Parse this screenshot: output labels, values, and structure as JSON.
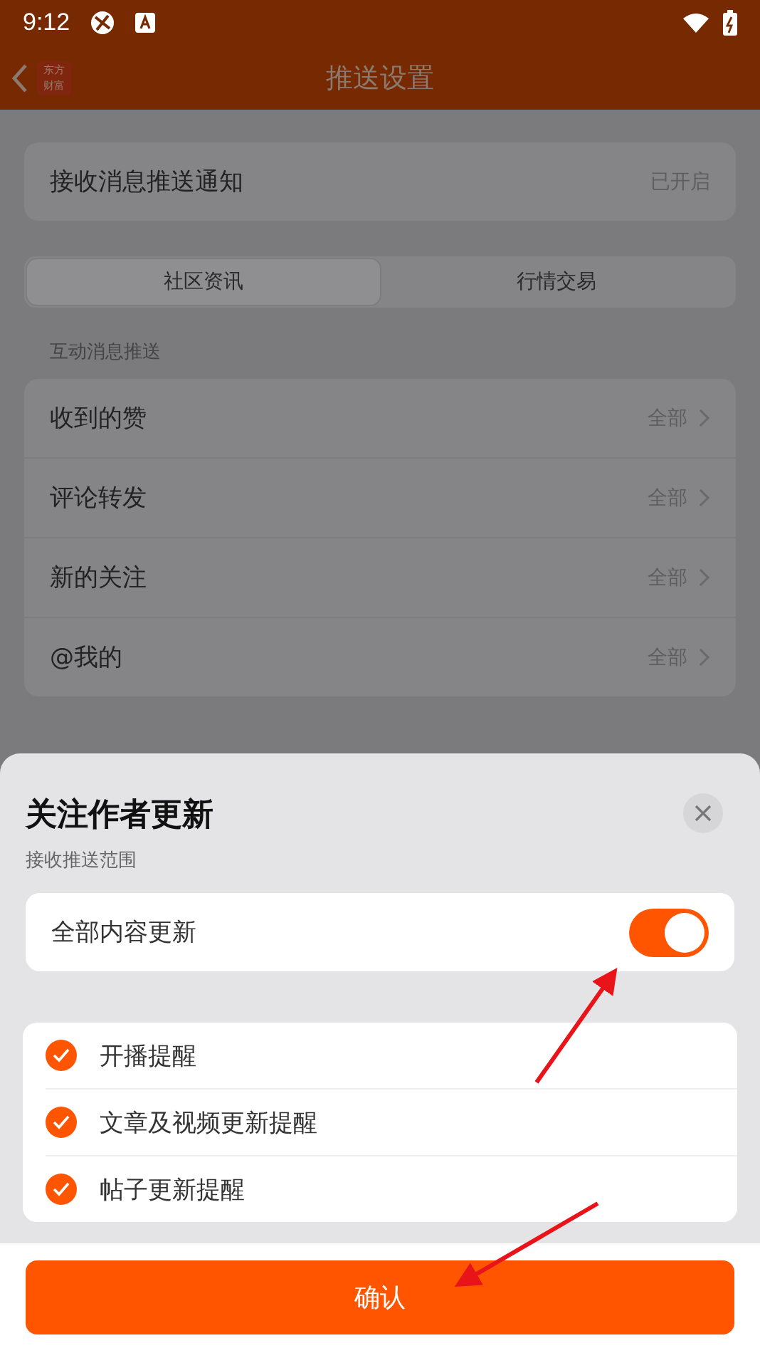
{
  "status_bar": {
    "time": "9:12"
  },
  "nav": {
    "logo_lines": [
      "东方",
      "财富"
    ],
    "title": "推送设置"
  },
  "push_notice": {
    "label": "接收消息推送通知",
    "value": "已开启"
  },
  "tabs": [
    {
      "label": "社区资讯",
      "selected": true
    },
    {
      "label": "行情交易",
      "selected": false
    }
  ],
  "section_title": "互动消息推送",
  "items": [
    {
      "label": "收到的赞",
      "value": "全部"
    },
    {
      "label": "评论转发",
      "value": "全部"
    },
    {
      "label": "新的关注",
      "value": "全部"
    },
    {
      "label": "@我的",
      "value": "全部"
    }
  ],
  "sheet": {
    "title": "关注作者更新",
    "subtitle": "接收推送范围",
    "toggle": {
      "label": "全部内容更新",
      "on": true
    },
    "options": [
      {
        "label": "开播提醒",
        "checked": true
      },
      {
        "label": "文章及视频更新提醒",
        "checked": true
      },
      {
        "label": "帖子更新提醒",
        "checked": true
      }
    ],
    "confirm": "确认"
  }
}
